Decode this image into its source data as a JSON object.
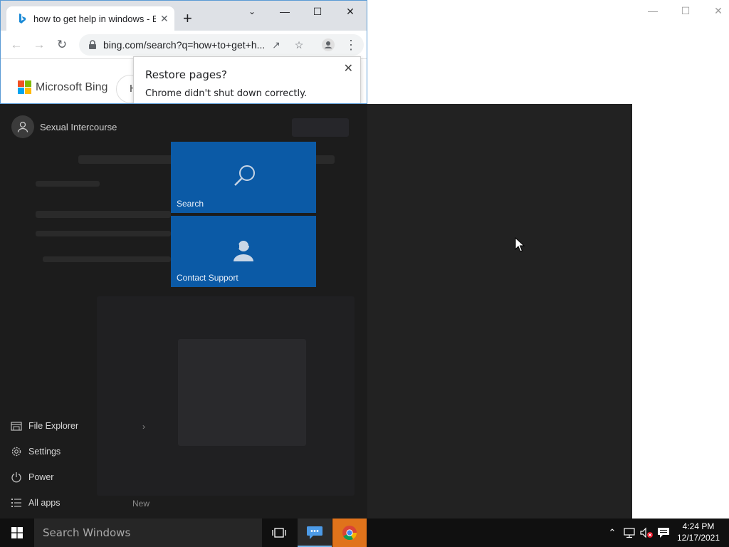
{
  "colors": {
    "accent": "#0b5aa6",
    "start_bg": "#222222",
    "taskbar_bg": "#101010",
    "chrome_active": "#e0731b"
  },
  "chrome": {
    "tab_title": "how to get help in windows - Bi",
    "tab_favicon": "bing-icon",
    "url": "bing.com/search?q=how+to+get+h...",
    "restore_popup": {
      "title": "Restore pages?",
      "message": "Chrome didn't shut down correctly."
    },
    "page": {
      "brand": "Microsoft Bing",
      "pill_letter": "H"
    }
  },
  "start_menu": {
    "user_name": "Sexual Intercourse",
    "tiles": [
      {
        "label": "Search",
        "icon": "search-icon"
      },
      {
        "label": "Contact Support",
        "icon": "support-agent-icon"
      }
    ],
    "items": [
      {
        "label": "File Explorer",
        "icon": "file-explorer-icon"
      },
      {
        "label": "Settings",
        "icon": "gear-icon"
      },
      {
        "label": "Power",
        "icon": "power-icon"
      },
      {
        "label": "All apps",
        "icon": "list-icon"
      }
    ],
    "new_badge": "New"
  },
  "taskbar": {
    "search_placeholder": "Search Windows",
    "time": "4:24 PM",
    "date": "12/17/2021"
  }
}
